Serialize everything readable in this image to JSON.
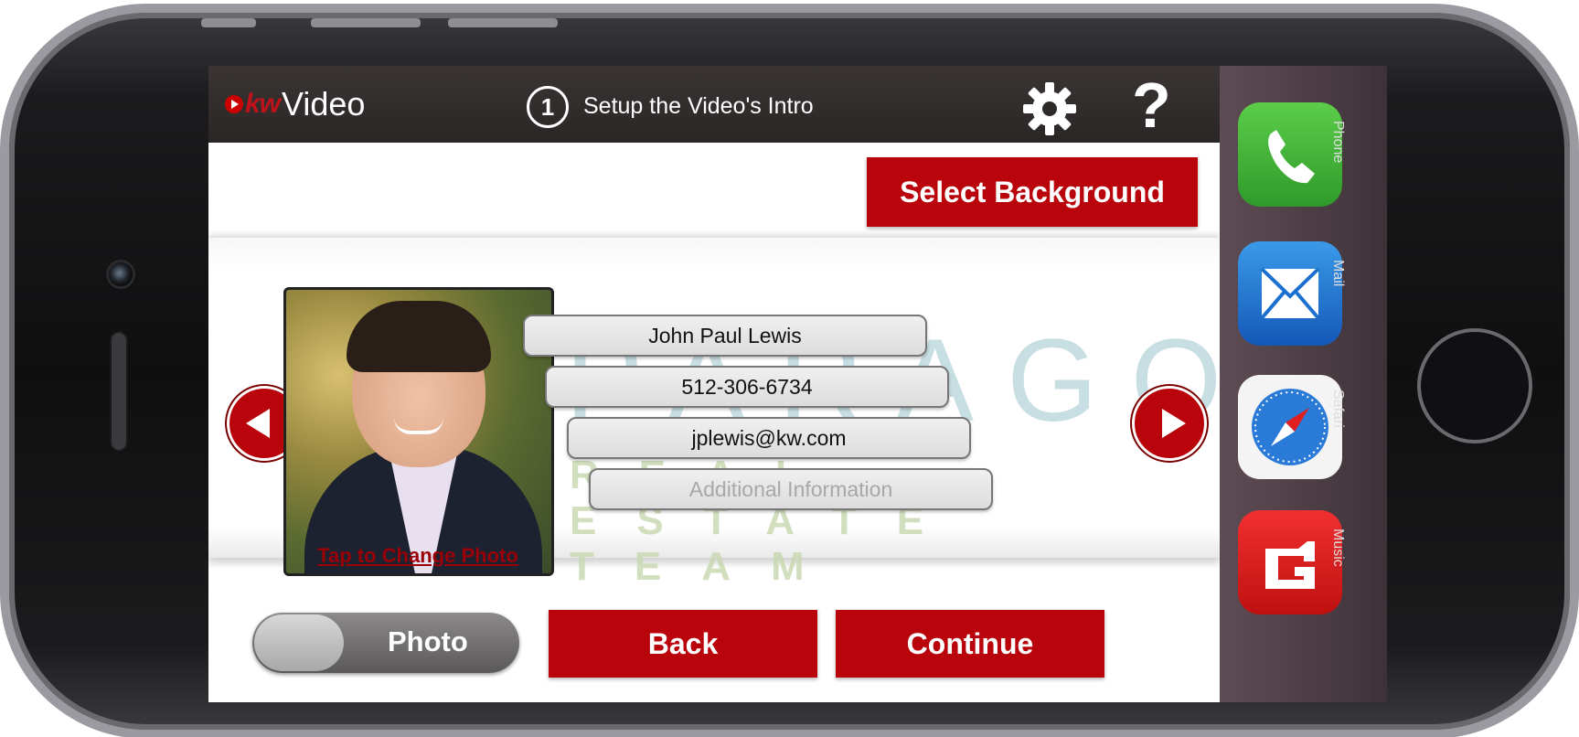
{
  "header": {
    "logo_brand": "kw",
    "logo_product": "Video",
    "step_number": "1",
    "step_label": "Setup the Video's Intro",
    "help_symbol": "?"
  },
  "actions": {
    "select_background": "Select Background",
    "back": "Back",
    "continue": "Continue"
  },
  "profile": {
    "photo_caption": "Tap to Change Photo",
    "name": "John Paul Lewis",
    "phone": "512-306-6734",
    "email": "jplewis@kw.com",
    "additional_placeholder": "Additional Information"
  },
  "watermark": {
    "main": "PARAGON",
    "sub": "REAL ESTATE TEAM"
  },
  "toggle": {
    "label": "Photo"
  },
  "dock": {
    "items": [
      {
        "label": "Phone",
        "icon": "phone-icon",
        "color": "#3fa535"
      },
      {
        "label": "Mail",
        "icon": "mail-icon",
        "color": "#1a6fd0"
      },
      {
        "label": "Safari",
        "icon": "safari-icon",
        "color": "#ffffff"
      },
      {
        "label": "Music",
        "icon": "music-icon",
        "color": "#e02020"
      }
    ]
  },
  "colors": {
    "accent": "#b8040a",
    "topbar": "#2e2a29"
  }
}
